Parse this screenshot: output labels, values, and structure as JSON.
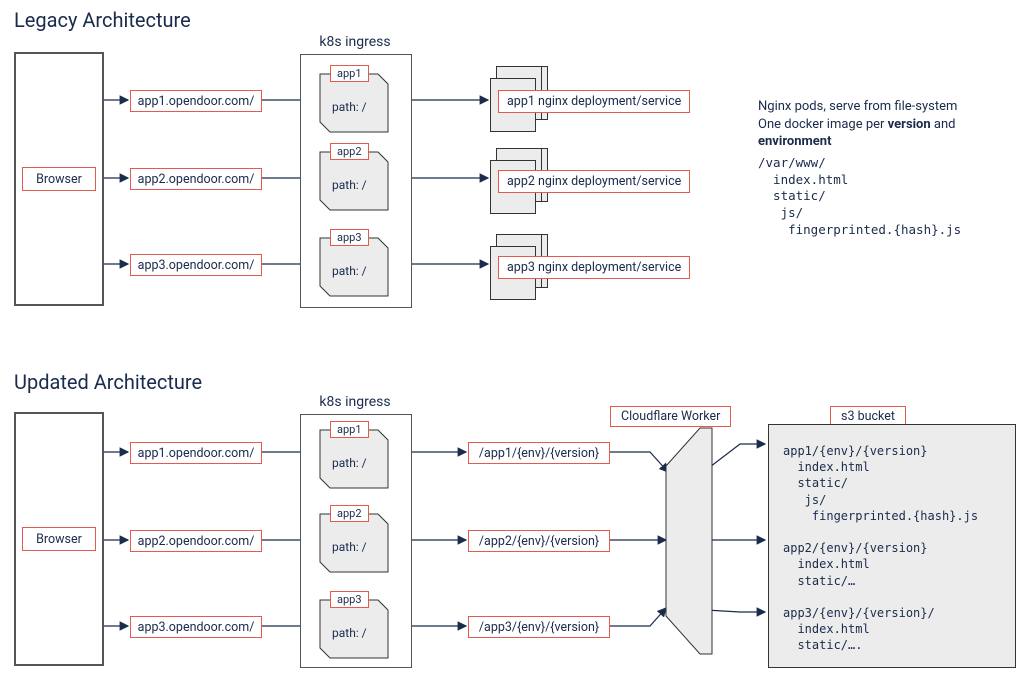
{
  "legacy": {
    "title": "Legacy Architecture",
    "browser": "Browser",
    "ingress_title": "k8s ingress",
    "urls": [
      "app1.opendoor.com/",
      "app2.opendoor.com/",
      "app3.opendoor.com/"
    ],
    "apps": [
      "app1",
      "app2",
      "app3"
    ],
    "path_label": "path: /",
    "deployments": [
      "app1 nginx deployment/service",
      "app2 nginx deployment/service",
      "app3 nginx deployment/service"
    ],
    "notes_line1": "Nginx pods, serve from file-system",
    "notes_line2a": "One docker image per ",
    "notes_bold1": "version",
    "notes_line2b": " and",
    "notes_bold2": "environment",
    "notes_code": "/var/www/\n  index.html\n  static/\n   js/\n    fingerprinted.{hash}.js"
  },
  "updated": {
    "title": "Updated Architecture",
    "browser": "Browser",
    "ingress_title": "k8s ingress",
    "urls": [
      "app1.opendoor.com/",
      "app2.opendoor.com/",
      "app3.opendoor.com/"
    ],
    "apps": [
      "app1",
      "app2",
      "app3"
    ],
    "path_label": "path: /",
    "rewrites": [
      "/app1/{env}/{version}",
      "/app2/{env}/{version}",
      "/app3/{env}/{version}"
    ],
    "cf_label": "Cloudflare Worker",
    "s3_label": "s3 bucket",
    "s3_content": "app1/{env}/{version}\n  index.html\n  static/\n   js/\n    fingerprinted.{hash}.js\n\napp2/{env}/{version}\n  index.html\n  static/…\n\napp3/{env}/{version}/\n  index.html\n  static/…."
  }
}
